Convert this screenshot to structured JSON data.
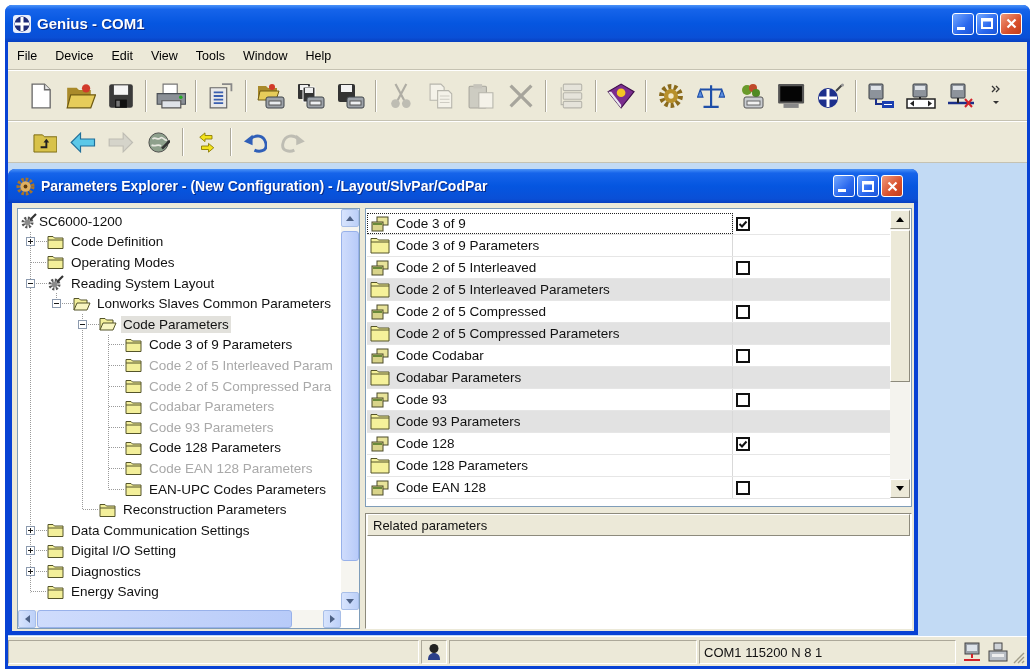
{
  "window": {
    "title": "Genius - COM1"
  },
  "menu": [
    "File",
    "Device",
    "Edit",
    "View",
    "Tools",
    "Window",
    "Help"
  ],
  "toolbars": [
    {
      "overflow": true,
      "groups": [
        [
          {
            "kind": "new",
            "disabled": false
          },
          {
            "kind": "open",
            "disabled": false
          },
          {
            "kind": "save",
            "disabled": false
          }
        ],
        [
          {
            "kind": "print",
            "disabled": false
          }
        ],
        [
          {
            "kind": "properties",
            "disabled": false
          }
        ],
        [
          {
            "kind": "device-open",
            "disabled": false
          },
          {
            "kind": "device-pages",
            "disabled": false
          },
          {
            "kind": "device-save",
            "disabled": false
          }
        ],
        [
          {
            "kind": "cut",
            "disabled": true
          },
          {
            "kind": "copy",
            "disabled": true
          },
          {
            "kind": "paste",
            "disabled": true
          },
          {
            "kind": "delete",
            "disabled": true
          }
        ],
        [
          {
            "kind": "list",
            "disabled": true
          }
        ],
        [
          {
            "kind": "help",
            "disabled": false
          }
        ],
        [
          {
            "kind": "gear",
            "disabled": false
          },
          {
            "kind": "scales",
            "disabled": false
          },
          {
            "kind": "plant",
            "disabled": false
          },
          {
            "kind": "monitor",
            "disabled": false
          },
          {
            "kind": "target",
            "disabled": false
          }
        ],
        [
          {
            "kind": "network",
            "disabled": false
          },
          {
            "kind": "network-drive",
            "disabled": false
          },
          {
            "kind": "network-cable",
            "disabled": false
          }
        ]
      ]
    },
    {
      "groups": [
        [
          {
            "kind": "folder-up",
            "disabled": false
          },
          {
            "kind": "back",
            "disabled": false
          },
          {
            "kind": "forward",
            "disabled": true
          },
          {
            "kind": "globe",
            "disabled": false
          }
        ],
        [
          {
            "kind": "sync",
            "disabled": false
          }
        ],
        [
          {
            "kind": "undo",
            "disabled": false
          },
          {
            "kind": "redo",
            "disabled": true
          }
        ]
      ]
    }
  ],
  "explorer": {
    "title": "Parameters Explorer - (New Configuration) - /Layout/SlvPar/CodPar",
    "tree": [
      {
        "label": "SC6000-1200",
        "kind": "device",
        "selected": false,
        "disabled": false,
        "children": [
          {
            "label": "Code Definition",
            "kind": "folder",
            "expanded": false,
            "selected": false,
            "disabled": false
          },
          {
            "label": "Operating Modes",
            "kind": "folder",
            "selected": false,
            "disabled": false
          },
          {
            "label": "Reading System Layout",
            "kind": "device",
            "expanded": true,
            "selected": false,
            "disabled": false,
            "children": [
              {
                "label": "Lonworks Slaves Common Parameters",
                "kind": "folder",
                "expanded": true,
                "selected": false,
                "disabled": false,
                "children": [
                  {
                    "label": "Code Parameters",
                    "kind": "folder",
                    "expanded": true,
                    "selected": true,
                    "disabled": false,
                    "children": [
                      {
                        "label": "Code 3 of 9 Parameters",
                        "kind": "folder",
                        "selected": false,
                        "disabled": false
                      },
                      {
                        "label": "Code 2 of 5 Interleaved Param",
                        "kind": "folder",
                        "selected": false,
                        "disabled": true
                      },
                      {
                        "label": "Code 2 of 5 Compressed Para",
                        "kind": "folder",
                        "selected": false,
                        "disabled": true
                      },
                      {
                        "label": "Codabar Parameters",
                        "kind": "folder",
                        "selected": false,
                        "disabled": true
                      },
                      {
                        "label": "Code 93 Parameters",
                        "kind": "folder",
                        "selected": false,
                        "disabled": true
                      },
                      {
                        "label": "Code 128 Parameters",
                        "kind": "folder",
                        "selected": false,
                        "disabled": false
                      },
                      {
                        "label": "Code EAN 128 Parameters",
                        "kind": "folder",
                        "selected": false,
                        "disabled": true
                      },
                      {
                        "label": "EAN-UPC Codes Parameters",
                        "kind": "folder",
                        "selected": false,
                        "disabled": false
                      }
                    ]
                  },
                  {
                    "label": "Reconstruction Parameters",
                    "kind": "folder",
                    "selected": false,
                    "disabled": false
                  }
                ]
              }
            ]
          },
          {
            "label": "Data Communication Settings",
            "kind": "folder",
            "expanded": false,
            "selected": false,
            "disabled": false
          },
          {
            "label": "Digital I/O Setting",
            "kind": "folder",
            "expanded": false,
            "selected": false,
            "disabled": false
          },
          {
            "label": "Diagnostics",
            "kind": "folder",
            "expanded": false,
            "selected": false,
            "disabled": false
          },
          {
            "label": "Energy Saving",
            "kind": "folder",
            "selected": false,
            "disabled": false
          }
        ]
      }
    ],
    "grid": {
      "rows": [
        {
          "kind": "code",
          "name": "Code 3 of 9",
          "checked": true,
          "selected": true
        },
        {
          "kind": "group",
          "name": "Code 3 of 9 Parameters",
          "disabled": false,
          "selected": false
        },
        {
          "kind": "code",
          "name": "Code 2 of 5 Interleaved",
          "checked": false,
          "selected": false
        },
        {
          "kind": "group",
          "name": "Code 2 of 5 Interleaved Parameters",
          "disabled": true,
          "selected": false
        },
        {
          "kind": "code",
          "name": "Code 2 of 5 Compressed",
          "checked": false,
          "selected": false
        },
        {
          "kind": "group",
          "name": "Code 2 of 5 Compressed Parameters",
          "disabled": true,
          "selected": false
        },
        {
          "kind": "code",
          "name": "Code Codabar",
          "checked": false,
          "selected": false
        },
        {
          "kind": "group",
          "name": "Codabar Parameters",
          "disabled": true,
          "selected": false
        },
        {
          "kind": "code",
          "name": "Code 93",
          "checked": false,
          "selected": false
        },
        {
          "kind": "group",
          "name": "Code 93 Parameters",
          "disabled": true,
          "selected": false
        },
        {
          "kind": "code",
          "name": "Code 128",
          "checked": true,
          "selected": false
        },
        {
          "kind": "group",
          "name": "Code 128 Parameters",
          "disabled": false,
          "selected": false
        },
        {
          "kind": "code",
          "name": "Code EAN 128",
          "checked": false,
          "selected": false
        }
      ]
    },
    "related": {
      "title": "Related parameters"
    }
  },
  "status_bar": {
    "connection": "COM1 115200 N 8 1"
  }
}
